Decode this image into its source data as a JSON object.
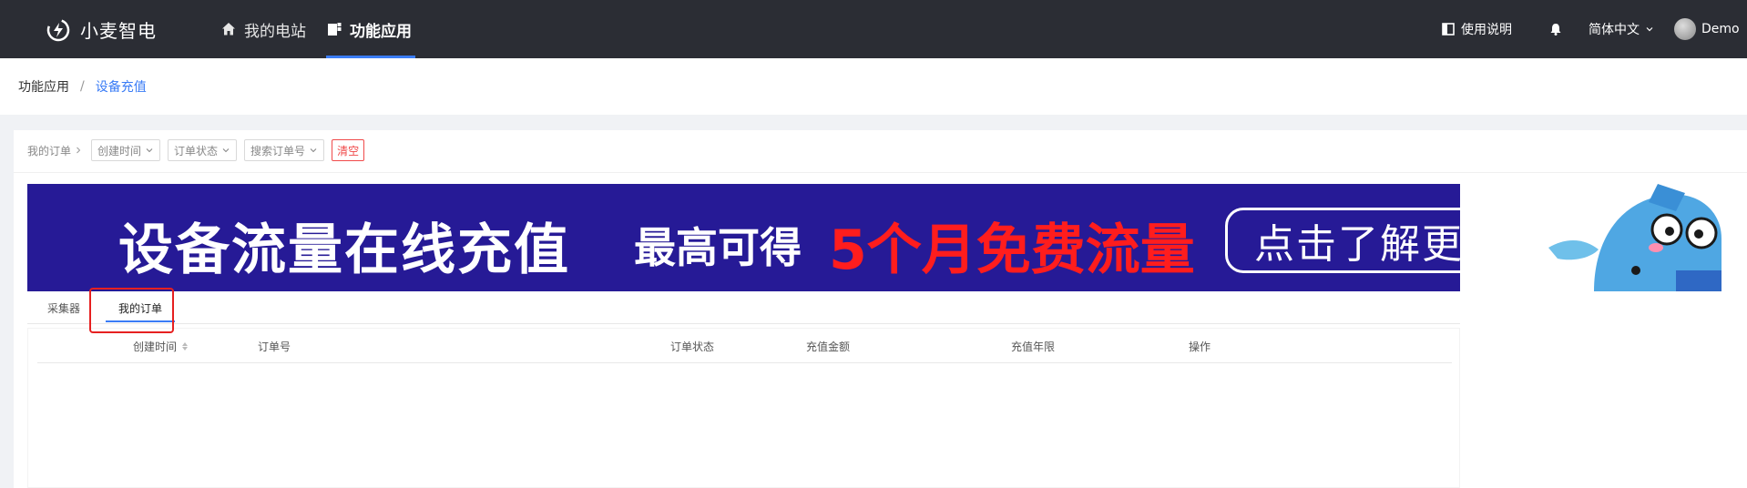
{
  "app": {
    "logo_text": "小麦智电"
  },
  "nav": {
    "items": [
      {
        "label": "我的电站",
        "icon": "home-icon"
      },
      {
        "label": "功能应用",
        "icon": "apps-icon",
        "active": true
      }
    ]
  },
  "header_right": {
    "manual_label": "使用说明",
    "language_label": "简体中文",
    "user_name": "Demo"
  },
  "breadcrumb": {
    "root": "功能应用",
    "separator": "/",
    "current": "设备充值"
  },
  "filters": {
    "my_orders_label": "我的订单",
    "created_time": "创建时间",
    "order_status": "订单状态",
    "search_order_no": "搜索订单号",
    "clear_label": "清空"
  },
  "banner": {
    "title": "设备流量在线充值",
    "subtitle": "最高可得",
    "highlight": "5个月免费流量",
    "cta": "点击了解更多"
  },
  "tabs": [
    {
      "label": "采集器",
      "active": false
    },
    {
      "label": "我的订单",
      "active": true
    }
  ],
  "table": {
    "columns": [
      "创建时间",
      "订单号",
      "订单状态",
      "充值金额",
      "充值年限",
      "操作"
    ],
    "rows": []
  },
  "colors": {
    "accent": "#3a7cf6",
    "topbar": "#2b2d34",
    "banner_bg": "#261a96",
    "danger": "#f04a4a"
  }
}
